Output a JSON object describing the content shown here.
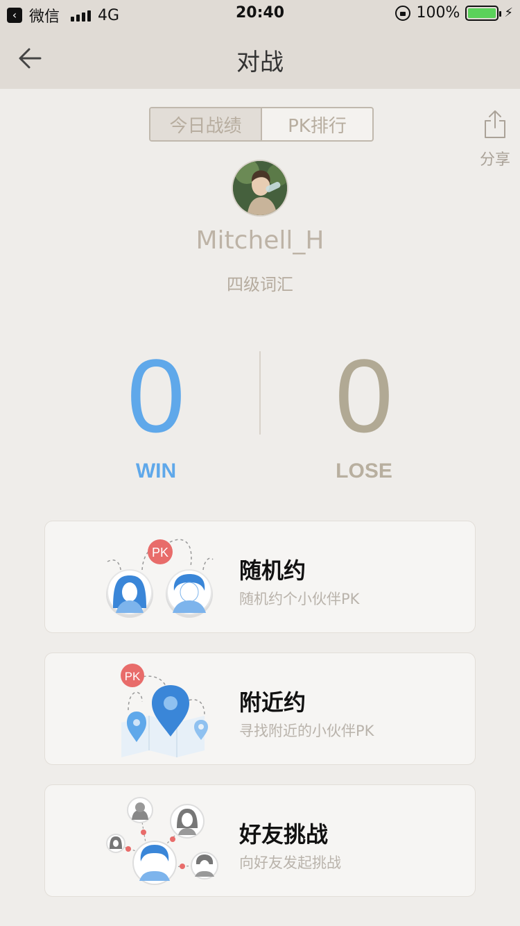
{
  "status": {
    "carrier": "微信",
    "network": "4G",
    "time": "20:40",
    "battery": "100%"
  },
  "nav": {
    "title": "对战"
  },
  "tabs": [
    {
      "label": "今日战绩",
      "active": true
    },
    {
      "label": "PK排行",
      "active": false
    }
  ],
  "share": {
    "label": "分享"
  },
  "profile": {
    "username": "Mitchell_H",
    "level": "四级词汇"
  },
  "score": {
    "win_value": "0",
    "win_label": "WIN",
    "lose_value": "0",
    "lose_label": "LOSE"
  },
  "modes": [
    {
      "title": "随机约",
      "subtitle": "随机约个小伙伴PK"
    },
    {
      "title": "附近约",
      "subtitle": "寻找附近的小伙伴PK"
    },
    {
      "title": "好友挑战",
      "subtitle": "向好友发起挑战"
    }
  ],
  "colors": {
    "win": "#5fa8ea",
    "lose": "#b1a994",
    "pk_badge": "#e86c6a",
    "header_bg": "#e0dbd5"
  }
}
